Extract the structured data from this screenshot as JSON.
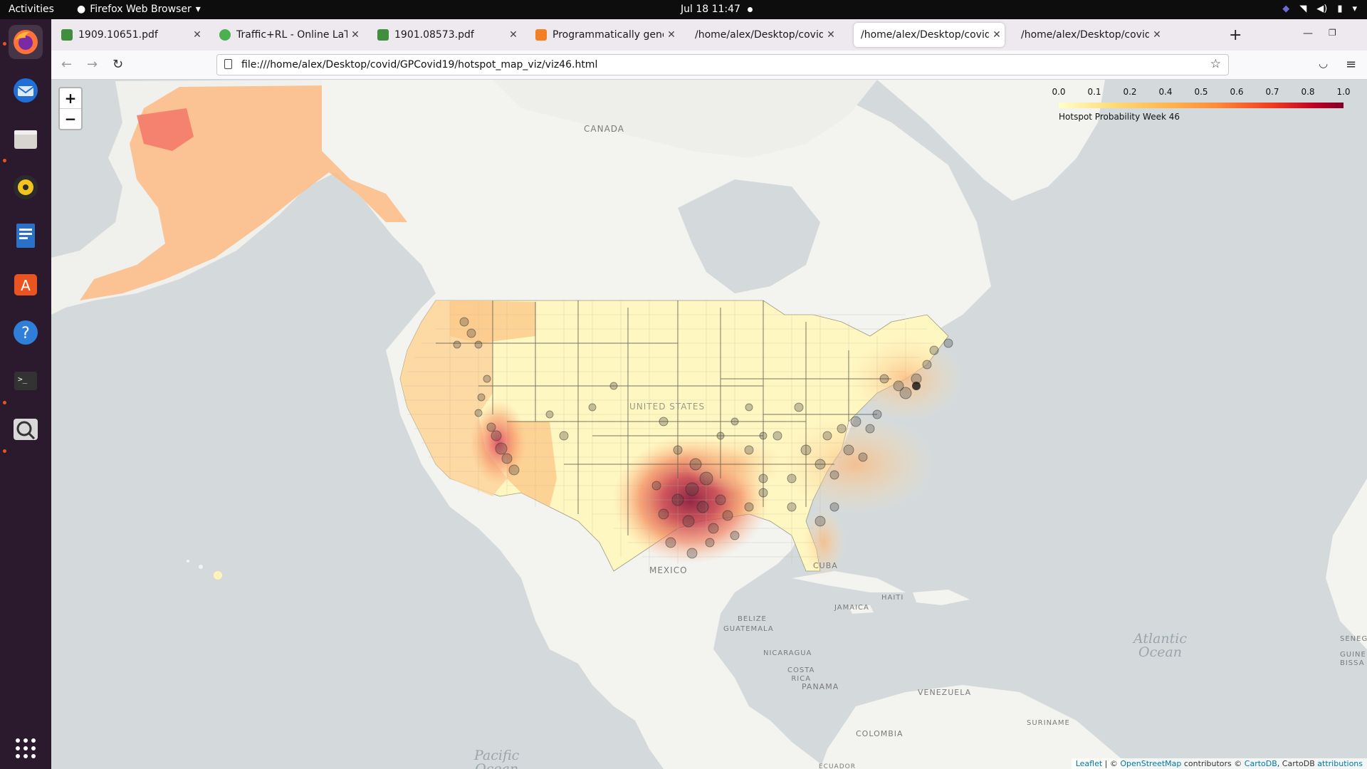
{
  "topbar": {
    "activities": "Activities",
    "app_name": "Firefox Web Browser",
    "clock": "Jul 18  11:47"
  },
  "dock": {
    "icons": [
      "firefox-icon",
      "thunderbird-icon",
      "files-icon",
      "rhythmbox-icon",
      "writer-icon",
      "software-icon",
      "help-icon",
      "terminal-icon",
      "magnifier-icon",
      "app-grid-icon"
    ]
  },
  "tabs": [
    {
      "label": "1909.10651.pdf",
      "favicon_color": "#2e7d32"
    },
    {
      "label": "Traffic+RL - Online LaTeX",
      "favicon_color": "#4caf50"
    },
    {
      "label": "1901.08573.pdf",
      "favicon_color": "#2e7d32"
    },
    {
      "label": "Programmatically genera",
      "favicon_color": "#f48024"
    },
    {
      "label": "/home/alex/Desktop/covid/G",
      "favicon_color": ""
    },
    {
      "label": "/home/alex/Desktop/covid/",
      "favicon_color": ""
    },
    {
      "label": "/home/alex/Desktop/covid/G",
      "favicon_color": ""
    }
  ],
  "active_tab_index": 5,
  "navbar": {
    "url": "file:///home/alex/Desktop/covid/GPCovid19/hotspot_map_viz/viz46.html"
  },
  "map": {
    "zoom_in": "+",
    "zoom_out": "−",
    "legend": {
      "ticks": [
        "0.0",
        "0.1",
        "0.2",
        "0.4",
        "0.5",
        "0.6",
        "0.7",
        "0.8",
        "1.0"
      ],
      "caption": "Hotspot Probability Week 46",
      "colors": [
        "#ffffcc",
        "#fed976",
        "#feb24c",
        "#fd8d3c",
        "#f03b20",
        "#bd0026",
        "#800026"
      ]
    },
    "labels": {
      "canada": "CANADA",
      "united_states": "UNITED STATES",
      "mexico": "MEXICO",
      "cuba": "CUBA",
      "haiti": "HAITI",
      "jamaica": "JAMAICA",
      "belize": "BELIZE",
      "guatemala": "GUATEMALA",
      "nicaragua": "NICARAGUA",
      "costa_rica": "COSTA\nRICA",
      "panama": "PANAMA",
      "venezuela": "VENEZUELA",
      "colombia": "COLOMBIA",
      "suriname": "SURINAME",
      "senegal": "SENEG",
      "guinea_bissau": "GUINE\nBISSA",
      "ecuador": "ECUADOR",
      "atlantic": "Atlantic\nOcean",
      "pacific": "Pacific\nOcean"
    },
    "attribution": {
      "leaflet": "Leaflet",
      "sep": " | © ",
      "osm": "OpenStreetMap",
      "contrib": " contributors © ",
      "cartodb": "CartoDB",
      "tail": ", CartoDB ",
      "attributions": "attributions"
    }
  }
}
